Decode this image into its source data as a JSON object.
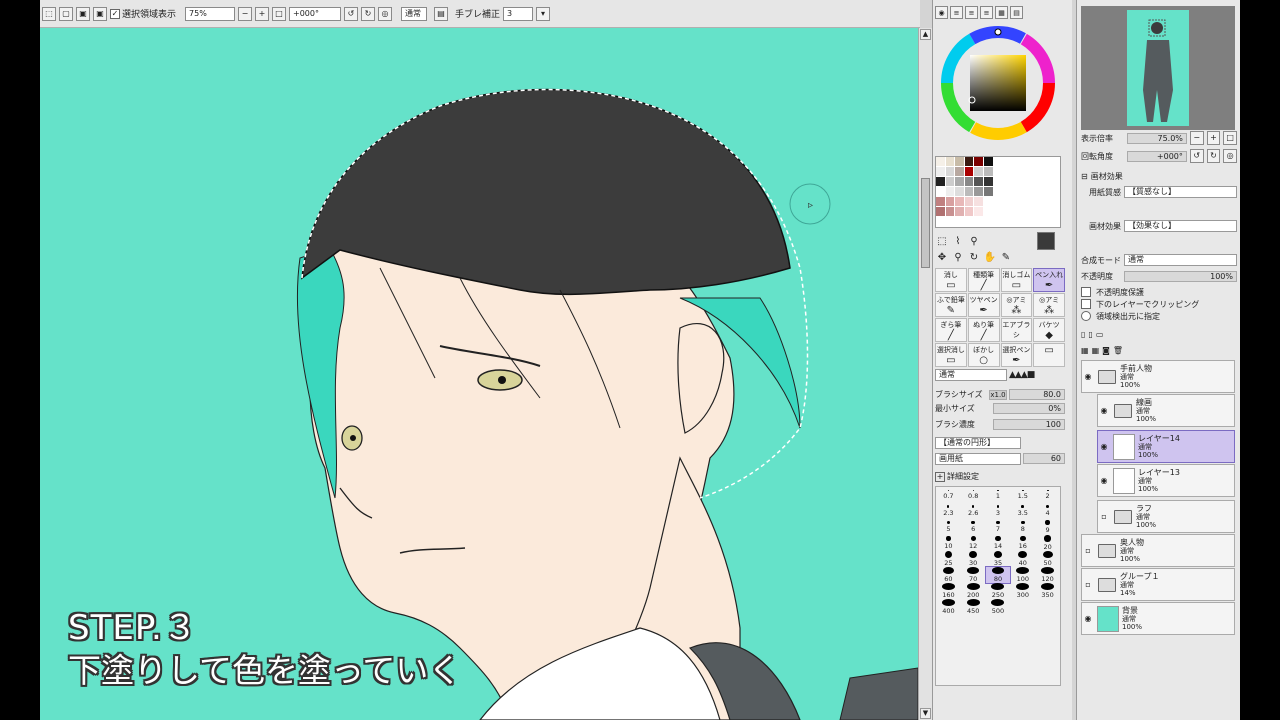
{
  "toolbar": {
    "selection_label": "選択領域表示",
    "zoom": "75%",
    "rotation": "+000°",
    "mode": "通常",
    "stabilizer_label": "手ブレ補正",
    "stabilizer_value": "3"
  },
  "overlay": {
    "step": "STEP.３",
    "caption": "下塗りして色を塗っていく"
  },
  "tools": {
    "brushes": [
      {
        "label": "消し",
        "icon": "eraser-icon"
      },
      {
        "label": "種類筆",
        "icon": "brush-icon"
      },
      {
        "label": "消しゴム",
        "icon": "eraser-icon"
      },
      {
        "label": "ペン入れ",
        "icon": "pen-icon"
      },
      {
        "label": "ふで鉛筆",
        "icon": "pencil-icon"
      },
      {
        "label": "ツヤペン",
        "icon": "pen-icon"
      },
      {
        "label": "◎アミ",
        "icon": "tone-icon"
      },
      {
        "label": "◎アミ",
        "icon": "tone-icon"
      },
      {
        "label": "ぎら筆",
        "icon": "brush-icon"
      },
      {
        "label": "ぬり筆",
        "icon": "brush-icon"
      },
      {
        "label": "エアブラシ",
        "icon": "airbrush-icon"
      },
      {
        "label": "バケツ",
        "icon": "bucket-icon"
      },
      {
        "label": "選択消し",
        "icon": "eraser-icon"
      },
      {
        "label": "ぼかし",
        "icon": "blur-icon"
      },
      {
        "label": "選択ペン",
        "icon": "pen-icon"
      },
      {
        "label": "",
        "icon": "eraser-icon"
      }
    ],
    "blend_mode": "通常",
    "brush_size_label": "ブラシサイズ",
    "brush_size_mult": "x1.0",
    "brush_size_value": "80.0",
    "min_size_label": "最小サイズ",
    "min_size_value": "0%",
    "density_label": "ブラシ濃度",
    "density_value": "100",
    "shape": "【通常の円形】",
    "paper": "画用紙",
    "paper_value": "60",
    "detail_label": "詳細設定",
    "sizes": [
      "0.7",
      "0.8",
      "1",
      "1.5",
      "2",
      "2.3",
      "2.6",
      "3",
      "3.5",
      "4",
      "5",
      "6",
      "7",
      "8",
      "9",
      "10",
      "12",
      "14",
      "16",
      "20",
      "25",
      "30",
      "35",
      "40",
      "50",
      "60",
      "70",
      "80",
      "100",
      "120",
      "160",
      "200",
      "250",
      "300",
      "350",
      "400",
      "450",
      "500"
    ]
  },
  "navigator": {
    "zoom_label": "表示倍率",
    "zoom_value": "75.0%",
    "angle_label": "回転角度",
    "angle_value": "+000°"
  },
  "paper_effect": {
    "title": "画材効果",
    "texture_label": "用紙質感",
    "texture_value": "【質感なし】",
    "effect_label": "画材効果",
    "effect_value": "【効果なし】",
    "blend_label": "合成モード",
    "blend_value": "通常",
    "opacity_label": "不透明度",
    "opacity_value": "100%",
    "protect_opacity": "不透明度保護",
    "clip": "下のレイヤーでクリッピング",
    "source": "領域検出元に指定"
  },
  "layers": [
    {
      "name": "手前人物",
      "mode": "通常",
      "opacity": "100%",
      "type": "folder",
      "visible": true
    },
    {
      "name": "線画",
      "mode": "通常",
      "opacity": "100%",
      "type": "folder",
      "visible": true
    },
    {
      "name": "レイヤー14",
      "mode": "通常",
      "opacity": "100%",
      "type": "layer",
      "visible": true,
      "selected": true
    },
    {
      "name": "レイヤー13",
      "mode": "通常",
      "opacity": "100%",
      "type": "layer",
      "visible": true
    },
    {
      "name": "ラフ",
      "mode": "通常",
      "opacity": "100%",
      "type": "folder",
      "visible": false
    },
    {
      "name": "奥人物",
      "mode": "通常",
      "opacity": "100%",
      "type": "folder",
      "visible": false
    },
    {
      "name": "グループ１",
      "mode": "通常",
      "opacity": "14%",
      "type": "folder",
      "visible": false
    },
    {
      "name": "背景",
      "mode": "通常",
      "opacity": "100%",
      "type": "layer",
      "visible": true
    }
  ],
  "colors": {
    "canvas_bg": "#65e2c9",
    "hair": "#3c3c3c",
    "skin": "#fbeadb",
    "selection": "#cfc4ef"
  }
}
